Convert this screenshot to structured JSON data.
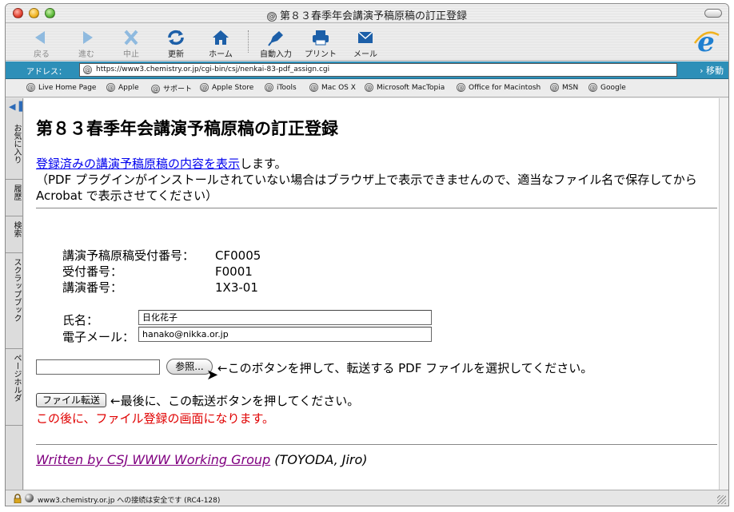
{
  "window": {
    "title": "第８３春季年会講演予稿原稿の訂正登録"
  },
  "toolbar": {
    "back": "戻る",
    "forward": "進む",
    "stop": "中止",
    "refresh": "更新",
    "home": "ホーム",
    "autofill": "自動入力",
    "print": "プリント",
    "mail": "メール"
  },
  "address": {
    "label": "アドレス：",
    "url": "https://www3.chemistry.or.jp/cgi-bin/csj/nenkai-83-pdf_assign.cgi",
    "go": "移動"
  },
  "favorites": [
    "Live Home Page",
    "Apple",
    "サポート",
    "Apple Store",
    "iTools",
    "Mac OS X",
    "Microsoft MacTopia",
    "Office for Macintosh",
    "MSN",
    "Google"
  ],
  "sidebar": {
    "tabs": [
      "お気に入り",
      "履歴",
      "検索",
      "スクラップブック",
      "ページホルダ"
    ]
  },
  "page": {
    "title": "第８３春季年会講演予稿原稿の訂正登録",
    "intro_link": "登録済みの講演予稿原稿の内容を表示",
    "intro_suffix": "します。",
    "intro_note": "（PDF プラグインがインストールされていない場合はブラウザ上で表示できませんので、適当なファイル名で保存してから Acrobat で表示させてください）",
    "info": [
      {
        "label": "講演予稿原稿受付番号：",
        "value": "CF0005"
      },
      {
        "label": "受付番号：",
        "value": "F0001"
      },
      {
        "label": "講演番号：",
        "value": "1X3-01"
      }
    ],
    "name_label": "氏名：",
    "name_value": "日化花子",
    "email_label": "電子メール：",
    "email_value": "hanako@nikka.or.jp",
    "browse_button": "参照...",
    "browse_note": "←このボタンを押して、転送する PDF ファイルを選択してください。",
    "submit_button": "ファイル転送",
    "submit_note": "←最後に、この転送ボタンを押してください。",
    "warning": "この後に、ファイル登録の画面になります。",
    "footer_link": "Written by CSJ WWW Working Group",
    "footer_author": " (TOYODA, Jiro)"
  },
  "status": {
    "text": "www3.chemistry.or.jp への接続は安全です (RC4-128)"
  },
  "colors": {
    "address_bar": "#2d8fb8",
    "link": "#0000ee",
    "visited_link": "#800080",
    "warning": "#e00000"
  }
}
